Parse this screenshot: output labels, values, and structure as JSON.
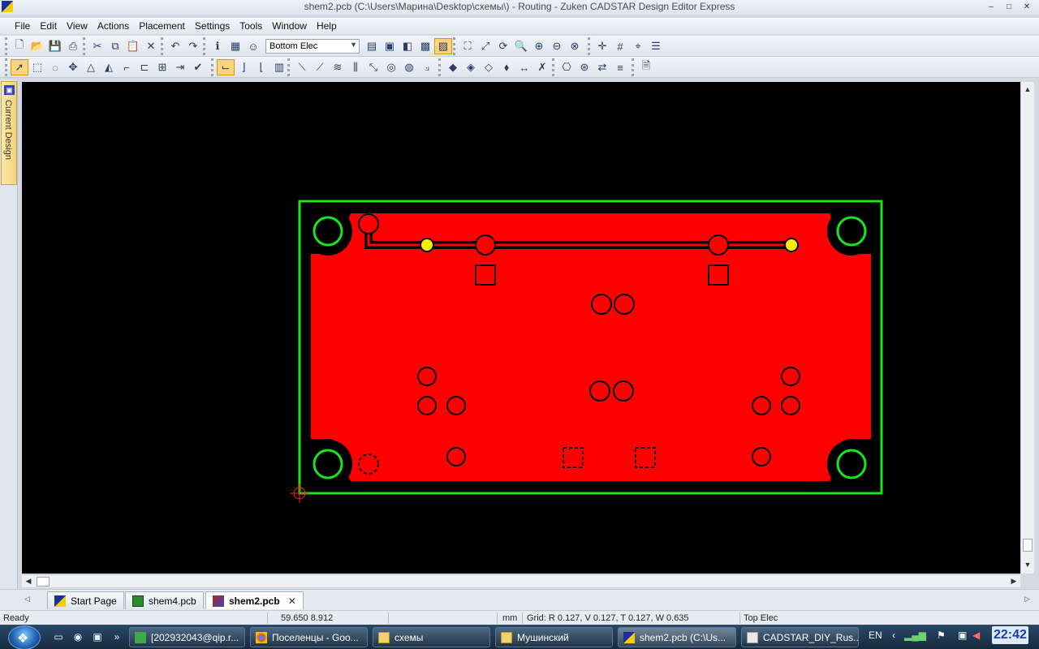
{
  "window": {
    "title": "shem2.pcb (C:\\Users\\Марина\\Desktop\\схемы\\) - Routing - Zuken CADSTAR Design Editor Express",
    "minimize": "–",
    "maximize": "□",
    "close": "✕"
  },
  "menu": {
    "items": [
      "File",
      "Edit",
      "View",
      "Actions",
      "Placement",
      "Settings",
      "Tools",
      "Window",
      "Help"
    ]
  },
  "toolbar": {
    "layer_select_value": "Bottom Elec"
  },
  "sidepane": {
    "tab_label": "Current Design"
  },
  "doc_tabs": {
    "tabs": [
      {
        "label": "Start Page"
      },
      {
        "label": "shem4.pcb"
      },
      {
        "label": "shem2.pcb",
        "active": true
      }
    ],
    "close_symbol": "✕"
  },
  "status": {
    "ready": "Ready",
    "coords": "59.650  8.912",
    "units": "mm",
    "grid": "Grid:  R 0.127, V 0.127, T 0.127, W 0.635",
    "layer": "Top Elec"
  },
  "taskbar": {
    "buttons": [
      {
        "label": "[202932043@qip.r..."
      },
      {
        "label": "Поселенцы - Goo..."
      },
      {
        "label": "схемы"
      },
      {
        "label": "Мушинский"
      },
      {
        "label": "shem2.pcb (C:\\Us...",
        "active": true
      },
      {
        "label": "CADSTAR_DIY_Rus..."
      }
    ],
    "lang": "EN",
    "clock": "22:42"
  },
  "colors": {
    "board_outline": "#19e619",
    "copper_pour": "#ff0000",
    "via_highlight": "#ffea00",
    "canvas_bg": "#000000"
  }
}
